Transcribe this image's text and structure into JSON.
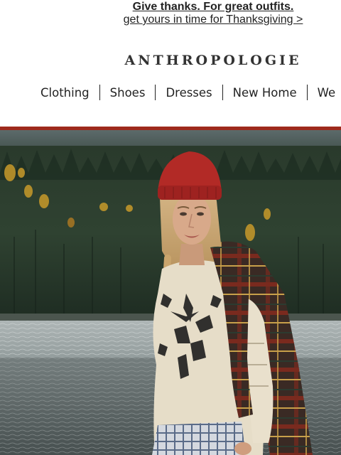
{
  "promo": {
    "headline": "Give thanks. For great outfits.",
    "subline": "get yours in time for Thanksgiving >"
  },
  "logo": {
    "text": "ANTHROPOLOGIE"
  },
  "nav": {
    "items": [
      {
        "label": "Clothing"
      },
      {
        "label": "Shoes"
      },
      {
        "label": "Dresses"
      },
      {
        "label": "New Home"
      },
      {
        "label": "We"
      }
    ]
  },
  "colors": {
    "accent": "#9e2a1c",
    "text": "#222222"
  },
  "hero": {
    "icon": "hero-photo"
  }
}
